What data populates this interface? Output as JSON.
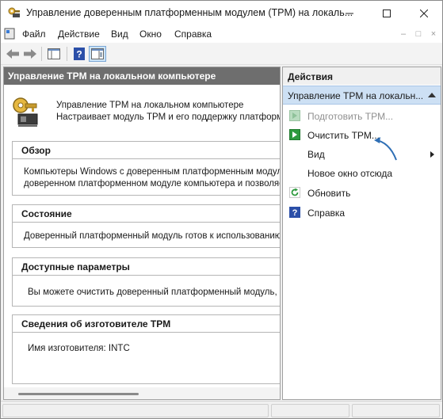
{
  "window": {
    "title": "Управление доверенным платформенным модулем (TPM) на локаль...",
    "icon": "tpm-key-icon"
  },
  "menu": {
    "items": [
      "Файл",
      "Действие",
      "Вид",
      "Окно",
      "Справка"
    ],
    "mdi_controls": [
      "–",
      "□",
      "×"
    ]
  },
  "toolbar": {
    "buttons": [
      "back-icon",
      "forward-icon",
      "console-tree-icon",
      "help-icon",
      "action-pane-icon"
    ]
  },
  "main": {
    "header": "Управление TPM на локальном компьютере",
    "intro": {
      "line1": "Управление TPM на локальном компьютере",
      "line2": "Настраивает модуль TPM и его поддержку платформо"
    },
    "sections": [
      {
        "title": "Обзор",
        "lines": [
          "Компьютеры Windows с доверенным платформенным модулем",
          "доверенном платформенном модуле компьютера и позволяет"
        ]
      },
      {
        "title": "Состояние",
        "lines": [
          "Доверенный платформенный модуль готов к использованию."
        ]
      },
      {
        "title": "Доступные параметры",
        "lines": [
          "Вы можете очистить доверенный платформенный модуль, что"
        ]
      },
      {
        "title": "Сведения об изготовителе TPM",
        "lines": [
          "Имя изготовителя:  INTC"
        ]
      }
    ]
  },
  "actions": {
    "title": "Действия",
    "group": "Управление TPM на локальн...",
    "items": [
      {
        "label": "Подготовить TPM...",
        "icon": "green-arrow-icon",
        "enabled": false
      },
      {
        "label": "Очистить TPM...",
        "icon": "green-arrow-icon",
        "enabled": true
      },
      {
        "label": "Вид",
        "icon": "",
        "enabled": true,
        "submenu": true
      },
      {
        "label": "Новое окно отсюда",
        "icon": "",
        "enabled": true
      },
      {
        "label": "Обновить",
        "icon": "refresh-icon",
        "enabled": true
      },
      {
        "label": "Справка",
        "icon": "help-icon",
        "enabled": true
      }
    ]
  },
  "colors": {
    "header_bg": "#6e6e6e",
    "selection_bg": "#cde0f4",
    "annotation_arrow": "#2f6fb5",
    "action_green": "#2e9a3e"
  }
}
